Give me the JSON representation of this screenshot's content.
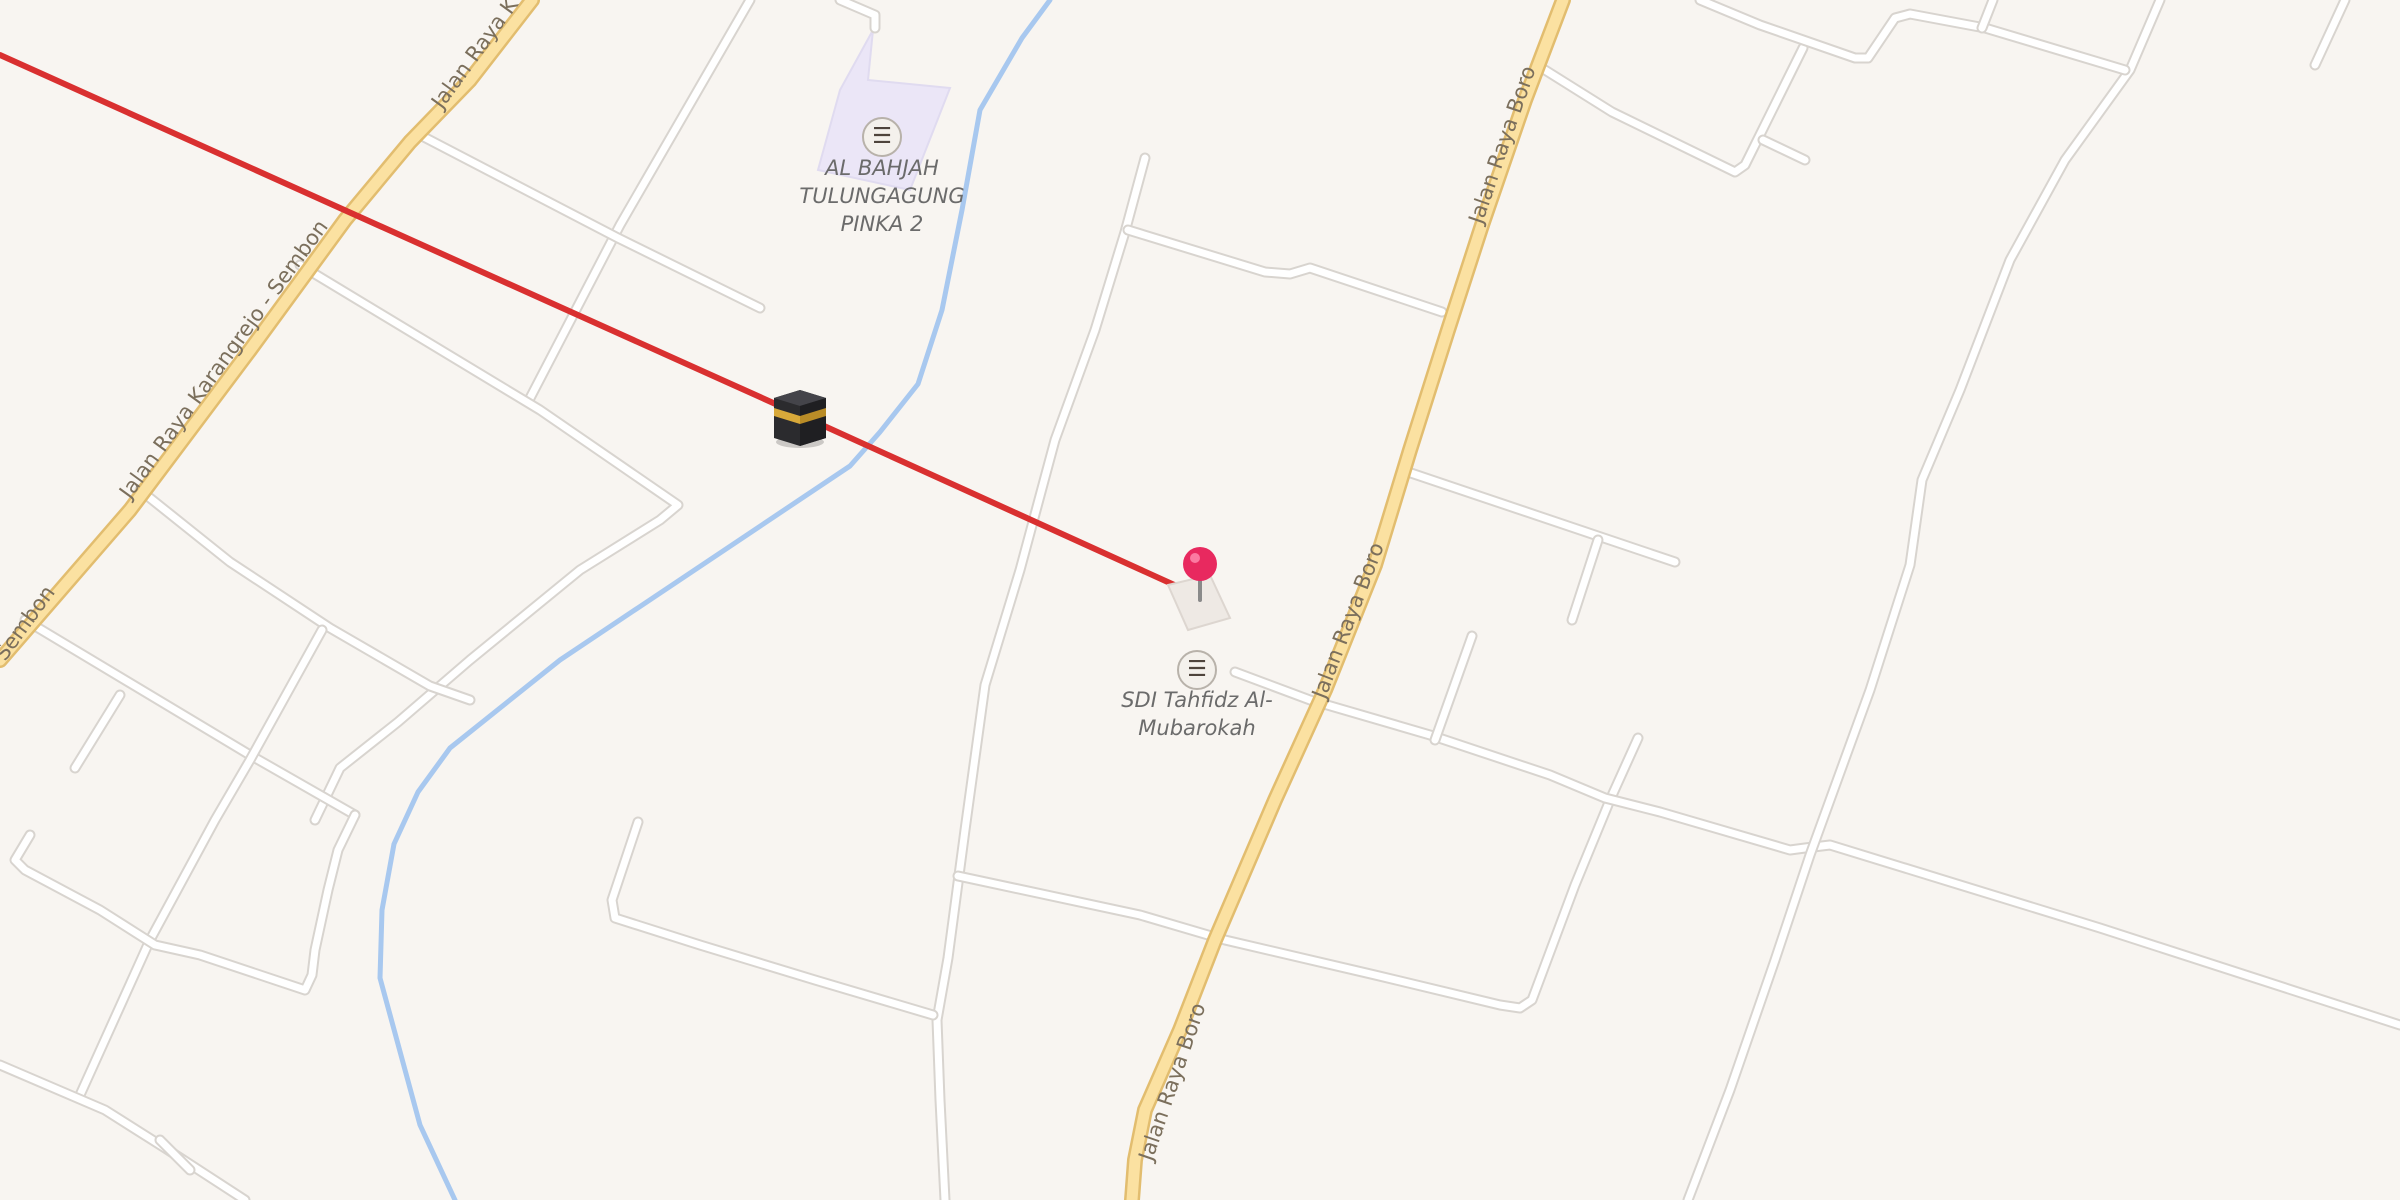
{
  "map": {
    "colors": {
      "background": "#f8f5f1",
      "minor_road": "#ffffff",
      "main_road": "#fbe1a1",
      "river": "#a8c8ef",
      "qibla_line": "#d93030",
      "school_area": "#ebe6f7",
      "pin": "#e8295f"
    },
    "road_labels": {
      "karangrejo": "Jalan Raya Karangrejo - Sembon",
      "karangrejo_top": "Jalan Raya K",
      "sembon": "Sembon",
      "boro_top": "Jalan Raya Boro",
      "boro_mid": "Jalan Raya Boro",
      "boro_bottom": "Jalan Raya Boro"
    },
    "pois": [
      {
        "label": "AL BAHJAH\nTULUNGAGUNG\nPINKA 2",
        "icon": "school-icon"
      },
      {
        "label": "SDI Tahfidz Al-\nMubarokah",
        "icon": "school-icon"
      }
    ],
    "markers": {
      "kaaba": "kaaba-icon",
      "location": "location-pin-icon"
    },
    "overlay": "qibla-direction-line"
  }
}
